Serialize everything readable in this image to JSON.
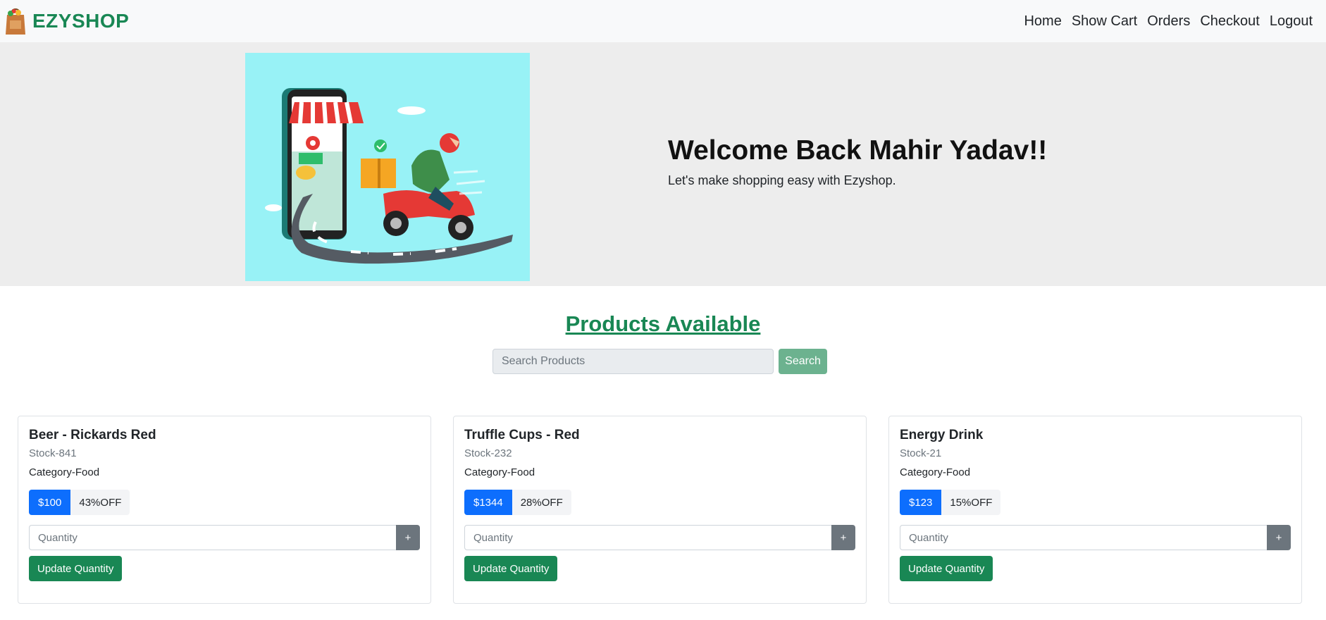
{
  "brand": {
    "name": "EZYSHOP",
    "logo_icon": "shopping-bag-icon",
    "color": "#198754"
  },
  "nav": {
    "links": [
      "Home",
      "Show Cart",
      "Orders",
      "Checkout",
      "Logout"
    ]
  },
  "hero": {
    "image_icon": "delivery-scooter-illustration",
    "title": "Welcome Back Mahir Yadav!!",
    "subtitle": "Let's make shopping easy with Ezyshop."
  },
  "products": {
    "title": "Products Available",
    "search_placeholder": "Search Products",
    "search_label": "Search"
  },
  "cards": [
    {
      "name": "Beer - Rickards Red",
      "stock": "Stock-841",
      "category": "Category-Food",
      "price": "$100",
      "discount": "43%OFF",
      "qty_placeholder": "Quantity",
      "plus_label": "+",
      "update_label": "Update Quantity"
    },
    {
      "name": "Truffle Cups - Red",
      "stock": "Stock-232",
      "category": "Category-Food",
      "price": "$1344",
      "discount": "28%OFF",
      "qty_placeholder": "Quantity",
      "plus_label": "+",
      "update_label": "Update Quantity"
    },
    {
      "name": "Energy Drink",
      "stock": "Stock-21",
      "category": "Category-Food",
      "price": "$123",
      "discount": "15%OFF",
      "qty_placeholder": "Quantity",
      "plus_label": "+",
      "update_label": "Update Quantity"
    }
  ],
  "colors": {
    "price_badge": "#0d6efd",
    "update_button": "#198754",
    "search_button": "#6cb28f",
    "hero_bg": "#ededed",
    "hero_image_bg": "#98f2f6"
  }
}
